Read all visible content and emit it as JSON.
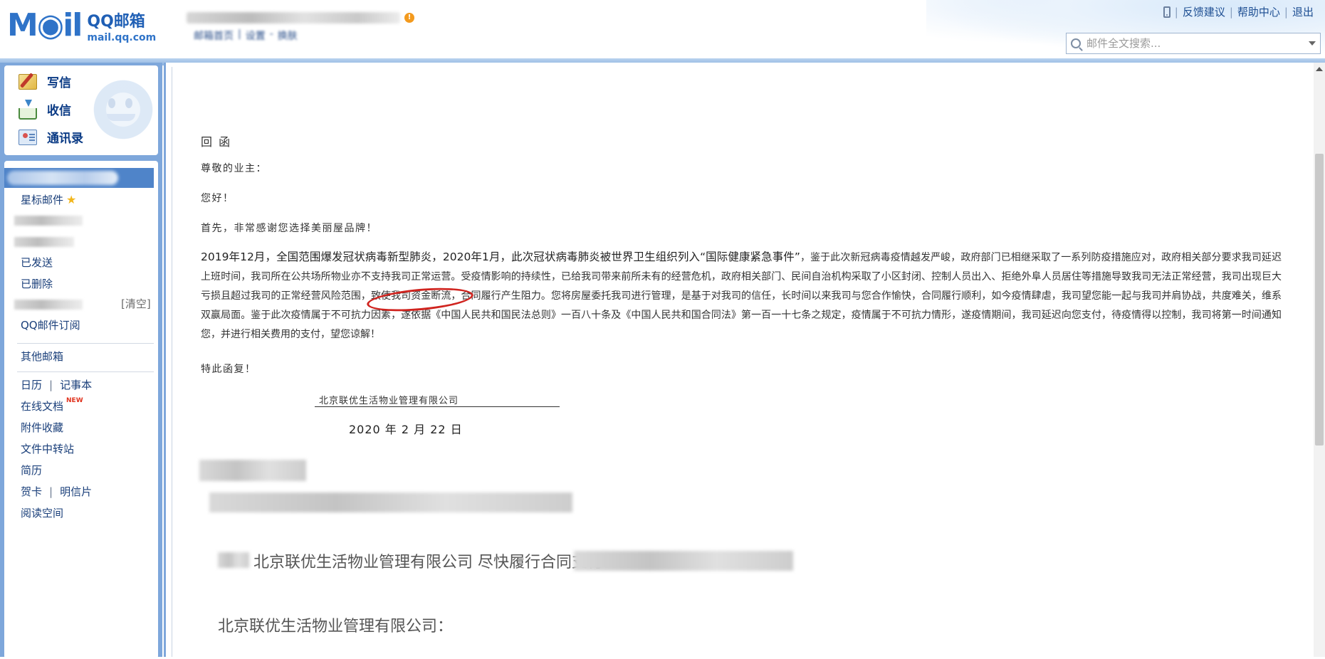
{
  "header": {
    "logo_mail": "M",
    "logo_mail_tail": "il",
    "logo_name": "QQ邮箱",
    "logo_domain": "mail.qq.com",
    "alert": "!",
    "subnav": [
      "邮箱首页",
      "设置",
      "换肤"
    ],
    "top_links": [
      "反馈建议",
      "帮助中心",
      "退出"
    ],
    "search_placeholder": "邮件全文搜索..."
  },
  "sidebar": {
    "actions": [
      {
        "label": "写信",
        "icon": "compose-icon"
      },
      {
        "label": "收信",
        "icon": "inbox-icon"
      },
      {
        "label": "通讯录",
        "icon": "contacts-icon"
      }
    ],
    "starred": "星标邮件",
    "sent": "已发送",
    "deleted": "已删除",
    "clear": "[清空]",
    "subscription": "QQ邮件订阅",
    "other_mailbox": "其他邮箱",
    "calendar": "日历",
    "notebook": "记事本",
    "online_docs": "在线文档",
    "new_badge": "NEW",
    "attachments": "附件收藏",
    "file_transfer": "文件中转站",
    "resume": "简历",
    "cards": "贺卡",
    "postcards": "明信片",
    "reading": "阅读空间"
  },
  "letter": {
    "title": "回 函",
    "greeting": "尊敬的业主：",
    "hello": "您好！",
    "thanks": "首先，非常感谢您选择美丽屋品牌！",
    "body_lead": "2019年12月，全国范围爆发冠状病毒新型肺炎，2020年1月，此次冠状病毒肺炎被世界卫生组织列入“国际健康紧急事件”",
    "body_part1": "，鉴于此次新冠病毒疫情越发严峻，政府部门已相继采取了一系列防疫措施应对，政府相关部分要求我司延迟上班时间，我司所在公共场所物业亦不支持我司正常运营。受疫情影响的持续性，已给我司带来前所未有的经营危机，政府相关部门、民间自治机构采取了小区封闭、控制人员出入、拒绝外阜人员居住等措施导致我司无法正常经营，我司出现巨大亏损且超过我司的正常经营风险范围，",
    "body_circled": "致使我司资金断流，",
    "body_part2": "合同履行产生阻力。您将房屋委托我司进行管理，是基于对我司的信任，长时间以来我司与您合作愉快，合同履行顺利，如今疫情肆虐，我司望您能一起与我司并肩协战，共度难关，维系双赢局面。鉴于此次疫情属于不可抗力因素，遂依据《中国人民共和国民法总则》一百八十条及《中国人民共和国合同法》第一百一十七条之规定，疫情属于不可抗力情形，遂疫情期间，我司延迟向您支付，待疫情得以控制，我司将第一时间通知您，并进行相关费用的支付，望您谅解！",
    "closing": "特此函复！",
    "company": "北京联优生活物业管理有限公司",
    "date": "2020  年 2  月 22 日"
  },
  "reply": {
    "line1_text": "北京联优生活物业管理有限公司  尽快履行合同支付",
    "line2_text": "北京联优生活物业管理有限公司："
  }
}
